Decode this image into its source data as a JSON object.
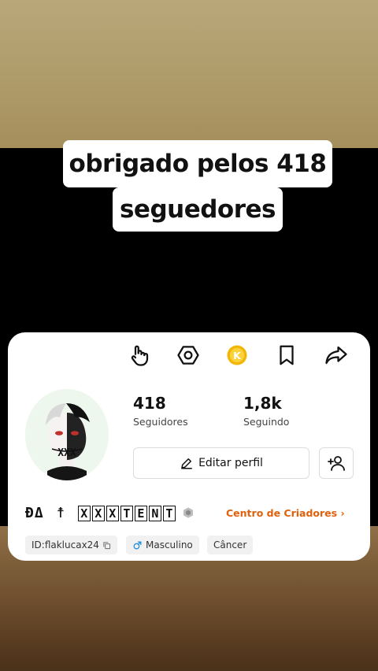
{
  "caption": {
    "line1": "obrigado pelos 418",
    "line2": "seguedores"
  },
  "toolbar": {
    "icons": [
      "tap-hand-icon",
      "hex-nut-icon",
      "gold-coin-icon",
      "bookmark-icon",
      "share-icon"
    ],
    "coin_letter": "K"
  },
  "profile": {
    "followers_count": "418",
    "followers_label": "Seguidores",
    "following_count": "1,8k",
    "following_label": "Seguindo",
    "edit_label": "Editar perfil",
    "name_prefix": "ÐΔ",
    "name_cross": "☨",
    "name_letters": [
      "X",
      "X",
      "X",
      "T",
      "E",
      "N",
      "T"
    ],
    "creator_label": "Centro de Criadores",
    "tags": {
      "id": "ID:flaklucax24",
      "gender": "Masculino",
      "sign": "Câncer"
    }
  },
  "colors": {
    "accent": "#e0600c",
    "coin": "#f2b705",
    "gender": "#1e8fe1"
  }
}
